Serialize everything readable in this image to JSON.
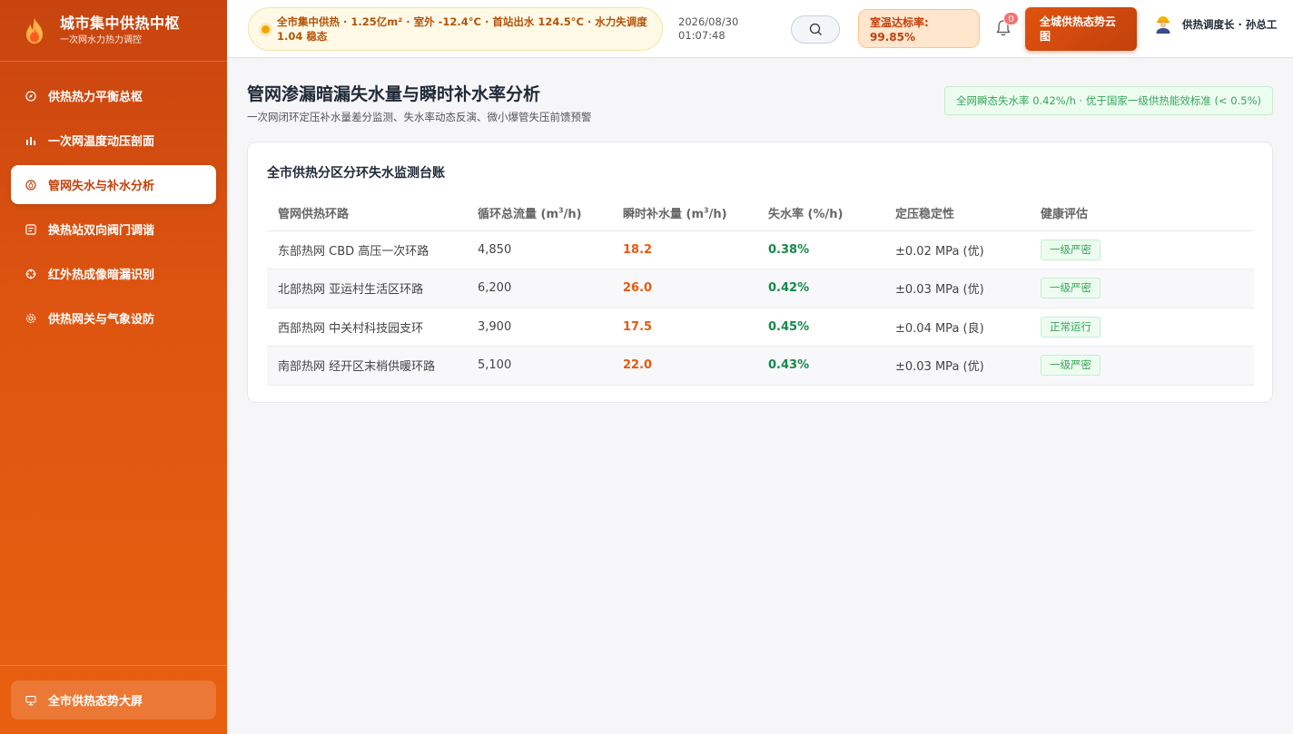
{
  "brand": {
    "title": "城市集中供热中枢",
    "subtitle": "一次网水力热力调控"
  },
  "sidebar": {
    "items": [
      {
        "label": "供热热力平衡总枢",
        "icon": "compass-icon"
      },
      {
        "label": "一次网温度动压剖面",
        "icon": "bar-chart-icon"
      },
      {
        "label": "管网失水与补水分析",
        "icon": "droplet-icon"
      },
      {
        "label": "换热站双向阀门调谐",
        "icon": "valve-icon"
      },
      {
        "label": "红外热成像暗漏识别",
        "icon": "crosshair-icon"
      },
      {
        "label": "供热网关与气象设防",
        "icon": "gear-icon"
      }
    ],
    "active_index": 2,
    "footer_label": "全市供热态势大屏"
  },
  "header": {
    "ticker_text": "全市集中供热 · 1.25亿m² · 室外 -12.4°C · 首站出水 124.5°C · 水力失调度 1.04 稳态",
    "date": "2026/08/30",
    "time": "01:07:48",
    "rate_badge": "室温达标率: 99.85%",
    "notification_count": "0",
    "cta_label": "全城供热态势云图",
    "user_name": "供热调度长 · 孙总工"
  },
  "page": {
    "title": "管网渗漏暗漏失水量与瞬时补水率分析",
    "subtitle": "一次网闭环定压补水量差分监测、失水率动态反演、微小爆管失压前馈预警",
    "notice": "全网瞬态失水率 0.42%/h · 优于国家一级供热能效标准 (< 0.5%)"
  },
  "table": {
    "title": "全市供热分区分环失水监测台账",
    "headers": {
      "loop": "管网供热环路",
      "flow_prefix": "循环总流量 (m",
      "flow_suffix": "/h)",
      "makeup_prefix": "瞬时补水量 (m",
      "makeup_suffix": "/h)",
      "loss": "失水率 (%/h)",
      "stability": "定压稳定性",
      "health": "健康评估",
      "exp": "3"
    },
    "rows": [
      {
        "loop": "东部热网 CBD 高压一次环路",
        "flow": "4,850",
        "makeup": "18.2",
        "loss": "0.38%",
        "stability": "±0.02 MPa (优)",
        "health": "一级严密"
      },
      {
        "loop": "北部热网 亚运村生活区环路",
        "flow": "6,200",
        "makeup": "26.0",
        "loss": "0.42%",
        "stability": "±0.03 MPa (优)",
        "health": "一级严密"
      },
      {
        "loop": "西部热网 中关村科技园支环",
        "flow": "3,900",
        "makeup": "17.5",
        "loss": "0.45%",
        "stability": "±0.04 MPa (良)",
        "health": "正常运行"
      },
      {
        "loop": "南部热网 经开区末梢供暖环路",
        "flow": "5,100",
        "makeup": "22.0",
        "loss": "0.43%",
        "stability": "±0.03 MPa (优)",
        "health": "一级严密"
      }
    ]
  },
  "colors": {
    "accent": "#c2410c",
    "sidebar": "#dd5410",
    "success": "#15894a",
    "warning": "#ea580c"
  }
}
